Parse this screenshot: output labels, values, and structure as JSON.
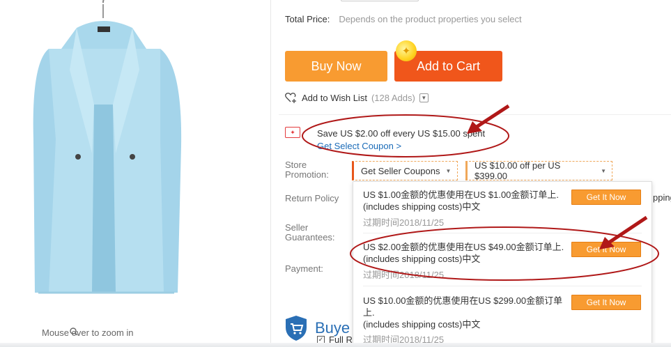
{
  "product": {
    "zoom_hint": "Mouse over to zoom in"
  },
  "pricing": {
    "total_label": "Total Price:",
    "total_value": "Depends on the product properties you select"
  },
  "actions": {
    "buy_now": "Buy Now",
    "add_to_cart": "Add to Cart",
    "wishlist_label": "Add to Wish List",
    "wishlist_count": "(128 Adds)"
  },
  "store_coupon": {
    "text": "Save US $2.00 off every US $15.00 spent",
    "link": "Get Select Coupon >"
  },
  "labels": {
    "store_promotion": "Store\nPromotion:",
    "return_policy": "Return Policy",
    "seller_guarantees": "Seller\nGuarantees:",
    "payment": "Payment:"
  },
  "promotions": {
    "seller_coupons": "Get Seller Coupons",
    "offer": "US $10.00 off per US $399.00"
  },
  "coupon_list": [
    {
      "desc": "US $1.00金额的优惠使用在US $1.00金额订单上.\n(includes shipping costs)中文",
      "expiry": "过期时间2018/11/25",
      "button": "Get It Now"
    },
    {
      "desc": "US $2.00金额的优惠使用在US $49.00金额订单上.\n(includes shipping costs)中文",
      "expiry": "过期时间2018/11/25",
      "button": "Get It Now"
    },
    {
      "desc": "US $10.00金额的优惠使用在US $299.00金额订单上.\n(includes shipping costs)中文",
      "expiry": "过期时间2018/11/25",
      "button": "Get It Now"
    }
  ],
  "right_cutoff_text": "pping",
  "buyer_protection": {
    "title": "Buye",
    "full": "Full R"
  },
  "colors": {
    "buy_now": "#f89b31",
    "add_to_cart": "#f0561b",
    "link": "#1a6bb8",
    "annotation": "#b01818"
  }
}
